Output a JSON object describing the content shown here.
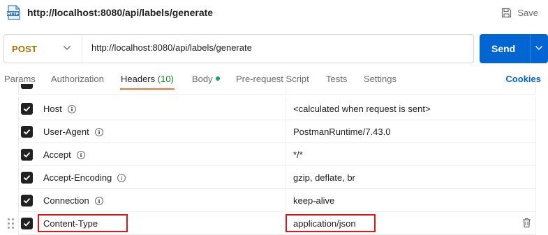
{
  "window": {
    "title": "http://localhost:8080/api/labels/generate",
    "save_label": "Save",
    "icon_text": "HTTP"
  },
  "request": {
    "method": "POST",
    "url": "http://localhost:8080/api/labels/generate",
    "send_label": "Send"
  },
  "tabs": [
    {
      "label": "Params"
    },
    {
      "label": "Authorization"
    },
    {
      "label": "Headers",
      "count": "(10)",
      "active": true
    },
    {
      "label": "Body"
    },
    {
      "label": "Pre-request Script"
    },
    {
      "label": "Tests"
    },
    {
      "label": "Settings"
    }
  ],
  "cookies_label": "Cookies",
  "headers": [
    {
      "key": "Host",
      "value": "<calculated when request is sent>",
      "checked": true
    },
    {
      "key": "User-Agent",
      "value": "PostmanRuntime/7.43.0",
      "checked": true
    },
    {
      "key": "Accept",
      "value": "*/*",
      "checked": true
    },
    {
      "key": "Accept-Encoding",
      "value": "gzip, deflate, br",
      "checked": true
    },
    {
      "key": "Connection",
      "value": "keep-alive",
      "checked": true
    },
    {
      "key": "Content-Type",
      "value": "application/json",
      "checked": true,
      "highlighted": true
    }
  ],
  "colors": {
    "send_button": "#0265d2",
    "method_post": "#a77200",
    "active_tab_underline": "#ff6c37",
    "header_count": "#0a8a1a",
    "highlight_box": "#e0161d"
  }
}
